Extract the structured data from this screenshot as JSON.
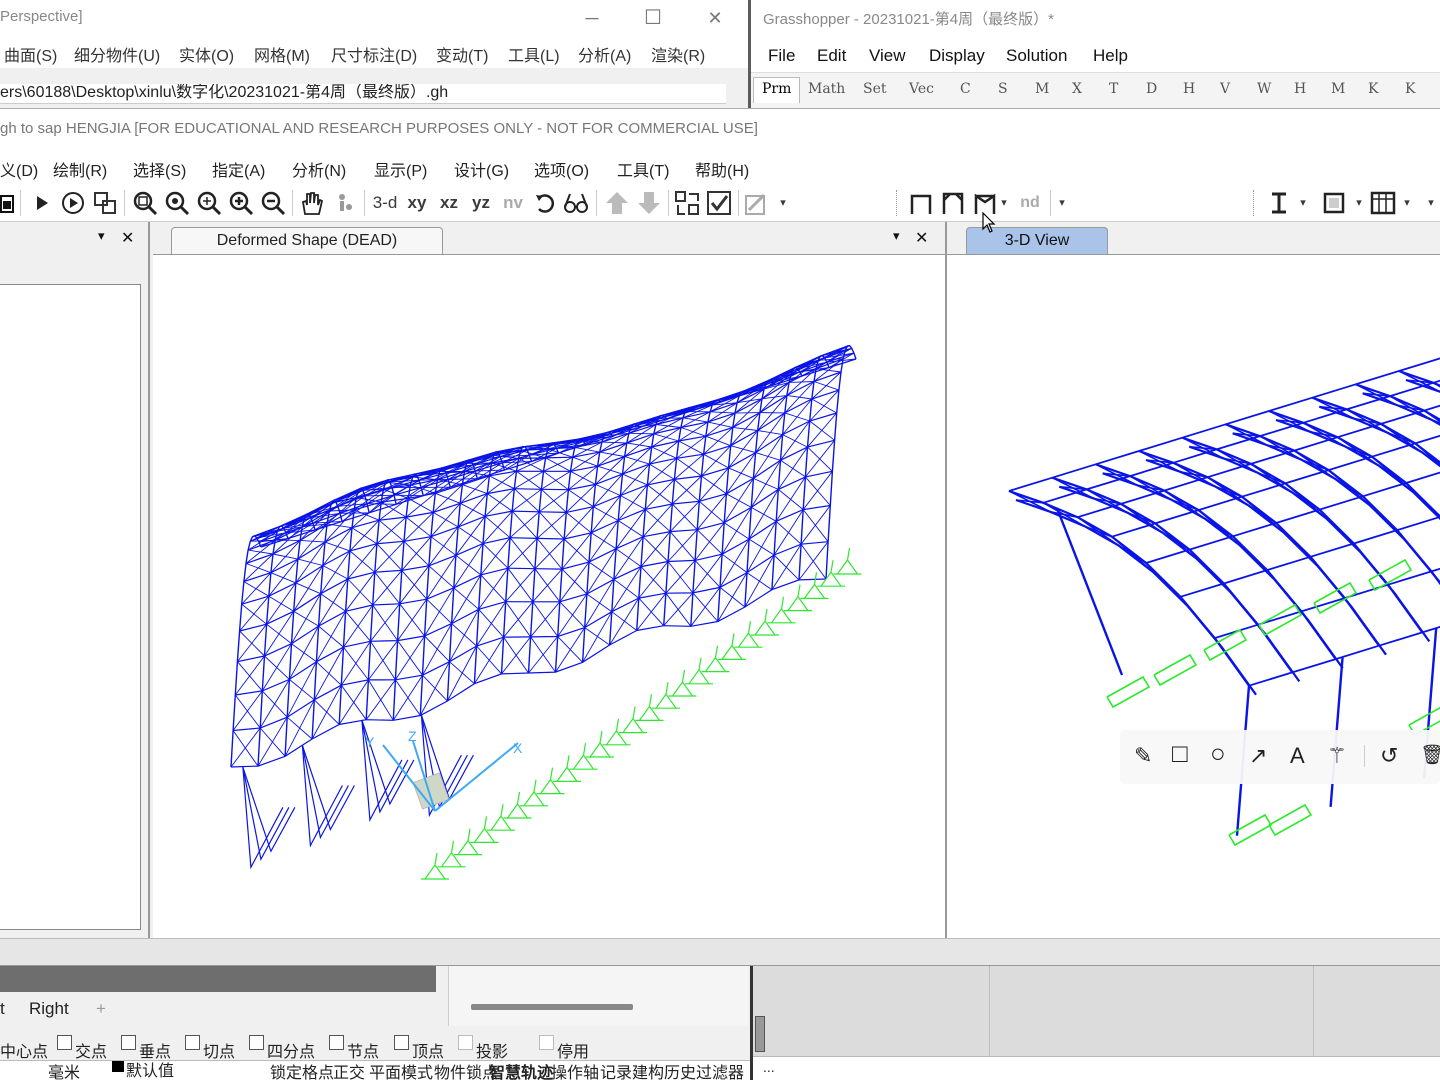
{
  "rhino": {
    "title": "Perspective]",
    "menu": [
      "曲面(S)",
      "细分物件(U)",
      "实体(O)",
      "网格(M)",
      "尺寸标注(D)",
      "变动(T)",
      "工具(L)",
      "分析(A)",
      "渲染(R)"
    ],
    "path": "ers\\60188\\Desktop\\xinlu\\数字化\\20231021-第4周（最终版）.gh",
    "viewport_tabs": [
      "t",
      "Right",
      "+"
    ],
    "osnap": [
      {
        "label": "中心点",
        "checked": false
      },
      {
        "label": "交点",
        "checked": false
      },
      {
        "label": "垂点",
        "checked": false
      },
      {
        "label": "切点",
        "checked": false
      },
      {
        "label": "四分点",
        "checked": false
      },
      {
        "label": "节点",
        "checked": false
      },
      {
        "label": "顶点",
        "checked": false
      },
      {
        "label": "投影",
        "checked": false
      },
      {
        "label": "停用",
        "checked": false
      }
    ],
    "status": [
      "毫米",
      "默认值",
      "锁定格点",
      "正交",
      "平面模式",
      "物件锁点",
      "智慧轨迹",
      "操作轴",
      "记录建构历史",
      "过滤器"
    ]
  },
  "grasshopper": {
    "title": "Grasshopper - 20231021-第4周（最终版）*",
    "menu": [
      "File",
      "Edit",
      "View",
      "Display",
      "Solution",
      "Help"
    ],
    "tabs": [
      "Prm",
      "Math",
      "Set",
      "Vec",
      "C",
      "S",
      "M",
      "X",
      "T",
      "D",
      "H",
      "V",
      "W",
      "H",
      "M",
      "K",
      "K"
    ],
    "status": "..."
  },
  "sap": {
    "title": "gh to sap HENGJIA  [FOR EDUCATIONAL AND RESEARCH PURPOSES ONLY - NOT FOR COMMERCIAL USE]",
    "menu": [
      "义(D)",
      "绘制(R)",
      "选择(S)",
      "指定(A)",
      "分析(N)",
      "显示(P)",
      "设计(G)",
      "选项(O)",
      "工具(T)",
      "帮助(H)"
    ],
    "toolbar_text": {
      "three_d": "3-d",
      "xy": "xy",
      "xz": "xz",
      "yz": "yz",
      "nv": "nv",
      "nd": "nd"
    },
    "mid_tab": "Deformed Shape (DEAD)",
    "right_tab": "3-D View",
    "structure_color": "#0a14e6",
    "support_color": "#2ee82e",
    "axis_labels": {
      "y": "Y",
      "z": "Z",
      "x": "X"
    }
  },
  "icons": {
    "win_min": "─",
    "win_max": "☐",
    "win_close": "✕",
    "tab_dropdown": "▾",
    "tab_close": "✕",
    "pencil": "✎",
    "rect": "□",
    "circle": "○",
    "arrow": "↗",
    "text": "A",
    "wand": "⚚",
    "undo": "↺",
    "trash": "🗑"
  }
}
